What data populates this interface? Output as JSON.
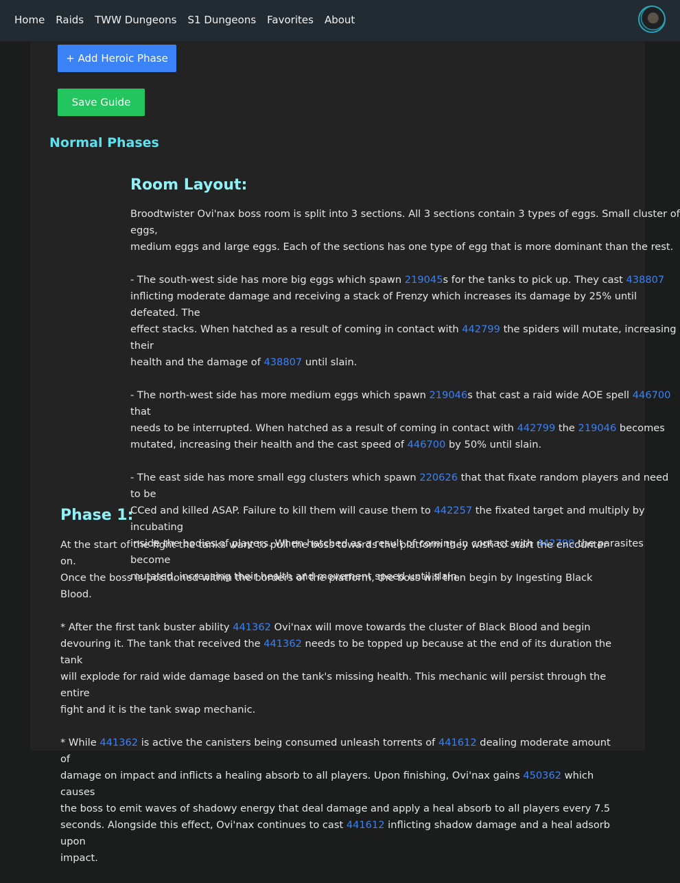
{
  "nav": {
    "links": [
      "Home",
      "Raids",
      "TWW Dungeons",
      "S1 Dungeons",
      "Favorites",
      "About"
    ]
  },
  "buttons": {
    "add_heroic_phase": "+ Add Heroic Phase",
    "save_guide": "Save Guide"
  },
  "section_title": "Normal Phases",
  "room_layout": {
    "heading": "Room Layout:",
    "intro": {
      "l1": "Broodtwister Ovi'nax boss room is split into 3 sections. All 3 sections contain 3 types of eggs. Small cluster of eggs,",
      "l2": "medium eggs and large eggs. Each of the sections has one type of egg that is more dominant than the rest."
    },
    "south_west": {
      "a": "- The south-west side has more big eggs which spawn ",
      "s1": "219045",
      "b": "s for the tanks to pick up. They cast ",
      "s2": "438807",
      "c": "inflicting moderate damage and receiving a stack of Frenzy which increases its damage by 25% until defeated. The",
      "d": "effect stacks. When hatched as a result of coming in contact with ",
      "s3": "442799",
      "e": " the spiders will mutate, increasing their",
      "f": "health and the damage of ",
      "s4": "438807",
      "g": " until slain."
    },
    "north_west": {
      "a": "- The north-west side has more medium eggs which spawn ",
      "s1": "219046",
      "b": "s that cast a raid wide AOE spell ",
      "s2": "446700",
      "c": " that",
      "d": "needs to be interrupted. When hatched as a result of coming in contact with ",
      "s3": "442799",
      "e": " the ",
      "s4": "219046",
      "f": " becomes",
      "g": "mutated, increasing their health and the cast speed of ",
      "s5": "446700",
      "h": " by 50% until slain."
    },
    "east": {
      "a": "- The east side has more small egg clusters which spawn ",
      "s1": "220626",
      "b": " that that fixate random players and need to be",
      "c": "CCed and killed ASAP. Failure to kill them will cause them to ",
      "s2": "442257",
      "d": " the fixated target and multiply by incubating",
      "e": "inside the bodies of players. When hatched as a result of coming in contact with ",
      "s3": "442799",
      "f": " the parasites become",
      "g": "mutated, increasing their health and movement speed until slain."
    }
  },
  "phase1": {
    "heading": "Phase 1:",
    "intro": {
      "l1": "At the start of the fight the tanks want to pull the boss towards the platform they wish to start the encounter on.",
      "l2": "Once the boss is positioned within the borders of the platform, the boss will then begin by Ingesting Black Blood."
    },
    "tank_buster": {
      "a": "* After the first tank buster ability ",
      "s1": "441362",
      "b": " Ovi'nax will move towards the cluster of Black Blood and begin",
      "c": "devouring it. The tank that received the ",
      "s2": "441362",
      "d": " needs to be topped up because at the end of its duration the tank",
      "e": "will explode for raid wide damage based on the tank's missing health. This mechanic will persist through the entire",
      "f": "fight and it is the tank swap mechanic."
    },
    "canisters": {
      "a": "* While ",
      "s1": "441362",
      "b": " is active the canisters being consumed unleash torrents of ",
      "s2": "441612",
      "c": " dealing moderate amount of",
      "d": "damage on impact and inflicts a healing absorb to all players. Upon finishing, Ovi'nax gains ",
      "s3": "450362",
      "e": " which causes",
      "f": "the boss to emit waves of shadowy energy that deal damage and apply a heal absorb to all players every 7.5",
      "g": "seconds. Alongside this effect, Ovi'nax continues to cast ",
      "s4": "441612",
      "h": " inflicting shadow damage and a heal adsorb upon",
      "i": "impact."
    }
  }
}
